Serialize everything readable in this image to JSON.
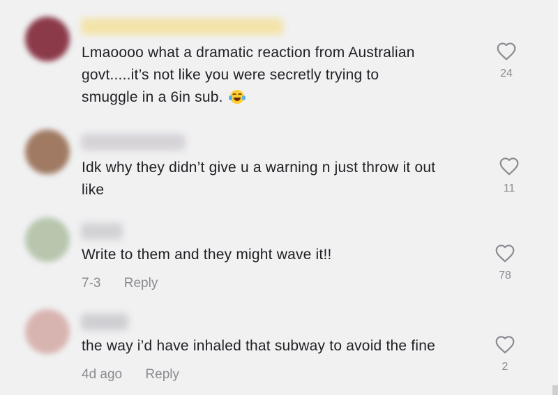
{
  "comments": [
    {
      "text_lines": [
        "Lmaoooo what a dramatic reaction from Australian",
        "govt.....it’s not like you were secretly trying to",
        "smuggle in a 6in sub."
      ],
      "emoji": "face-with-tears-of-joy-icon",
      "likes": "24",
      "avatar_color": "#8b3a4a",
      "username_color": "#f3e3a8"
    },
    {
      "text_lines": [
        "Idk why they didn’t give u a warning n just throw it out",
        "like"
      ],
      "likes": "11",
      "avatar_color": "#a07a62",
      "username_color": "#d6d3d8"
    },
    {
      "text_lines": [
        "Write to them and they might wave it!!"
      ],
      "date": "7-3",
      "reply_label": "Reply",
      "likes": "78",
      "avatar_color": "#b8c6ae",
      "username_color": "#d2d2d6"
    },
    {
      "text_lines": [
        "the way i’d have inhaled that subway to avoid the fine"
      ],
      "date": "4d ago",
      "reply_label": "Reply",
      "likes": "2",
      "avatar_color": "#d8b4b0",
      "username_color": "#cfcfd3"
    }
  ],
  "colors": {
    "background": "#f1f1f2",
    "text": "#1f1f24",
    "meta": "#8a8b91"
  }
}
